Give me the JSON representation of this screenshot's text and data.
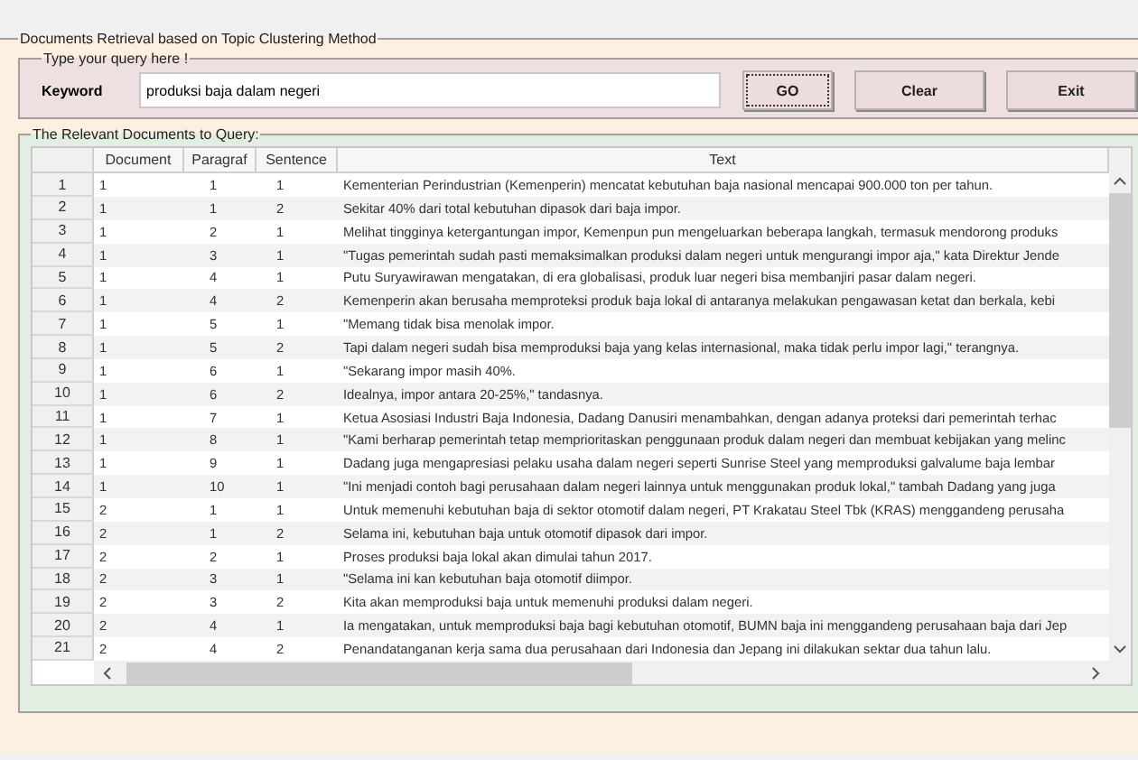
{
  "main_panel": {
    "title": "Documents Retrieval based on Topic Clustering Method"
  },
  "query_panel": {
    "title": "Type your query here !",
    "keyword_label": "Keyword",
    "keyword_value": "produksi baja dalam negeri",
    "buttons": [
      {
        "label": "GO",
        "focused": true
      },
      {
        "label": "Clear",
        "focused": false
      },
      {
        "label": "Exit",
        "focused": false
      }
    ]
  },
  "results_panel": {
    "title": "The Relevant Documents to Query:",
    "table": {
      "columns": [
        "Document",
        "Paragraf",
        "Sentence",
        "Text"
      ],
      "rows": [
        {
          "num": "1",
          "document": "1",
          "paragraf": "1",
          "sentence": "1",
          "text": "Kementerian Perindustrian (Kemenperin) mencatat kebutuhan baja nasional mencapai 900.000 ton per tahun."
        },
        {
          "num": "2",
          "document": "1",
          "paragraf": "1",
          "sentence": "2",
          "text": "Sekitar 40% dari total kebutuhan dipasok dari baja impor."
        },
        {
          "num": "3",
          "document": "1",
          "paragraf": "2",
          "sentence": "1",
          "text": "Melihat tingginya ketergantungan impor, Kemenpun pun mengeluarkan beberapa langkah, termasuk mendorong produks"
        },
        {
          "num": "4",
          "document": "1",
          "paragraf": "3",
          "sentence": "1",
          "text": "\"Tugas pemerintah sudah pasti memaksimalkan produksi dalam negeri untuk mengurangi impor aja,\" kata Direktur Jende"
        },
        {
          "num": "5",
          "document": "1",
          "paragraf": "4",
          "sentence": "1",
          "text": "Putu Suryawirawan mengatakan, di era globalisasi, produk luar negeri bisa membanjiri pasar dalam negeri."
        },
        {
          "num": "6",
          "document": "1",
          "paragraf": "4",
          "sentence": "2",
          "text": "Kemenperin akan berusaha memproteksi produk baja lokal di antaranya melakukan pengawasan ketat dan berkala, kebi"
        },
        {
          "num": "7",
          "document": "1",
          "paragraf": "5",
          "sentence": "1",
          "text": "\"Memang tidak bisa menolak impor."
        },
        {
          "num": "8",
          "document": "1",
          "paragraf": "5",
          "sentence": "2",
          "text": "Tapi dalam negeri sudah bisa memproduksi baja yang kelas internasional, maka tidak perlu impor lagi,\" terangnya."
        },
        {
          "num": "9",
          "document": "1",
          "paragraf": "6",
          "sentence": "1",
          "text": "\"Sekarang impor masih 40%."
        },
        {
          "num": "10",
          "document": "1",
          "paragraf": "6",
          "sentence": "2",
          "text": "Idealnya, impor antara 20-25%,\" tandasnya."
        },
        {
          "num": "11",
          "document": "1",
          "paragraf": "7",
          "sentence": "1",
          "text": "Ketua Asosiasi Industri Baja Indonesia, Dadang Danusiri menambahkan, dengan adanya proteksi dari pemerintah terhac"
        },
        {
          "num": "12",
          "document": "1",
          "paragraf": "8",
          "sentence": "1",
          "text": "\"Kami berharap pemerintah tetap memprioritaskan penggunaan produk dalam negeri dan membuat kebijakan yang melinc"
        },
        {
          "num": "13",
          "document": "1",
          "paragraf": "9",
          "sentence": "1",
          "text": "Dadang juga mengapresiasi pelaku usaha dalam negeri seperti Sunrise Steel yang memproduksi galvalume baja lembar"
        },
        {
          "num": "14",
          "document": "1",
          "paragraf": "10",
          "sentence": "1",
          "text": "\"Ini menjadi contoh bagi perusahaan dalam negeri lainnya untuk menggunakan produk lokal,\" tambah Dadang yang juga"
        },
        {
          "num": "15",
          "document": "2",
          "paragraf": "1",
          "sentence": "1",
          "text": "Untuk memenuhi kebutuhan baja di sektor otomotif dalam negeri, PT Krakatau Steel Tbk (KRAS) menggandeng perusaha"
        },
        {
          "num": "16",
          "document": "2",
          "paragraf": "1",
          "sentence": "2",
          "text": "Selama ini, kebutuhan baja untuk otomotif dipasok dari impor."
        },
        {
          "num": "17",
          "document": "2",
          "paragraf": "2",
          "sentence": "1",
          "text": "Proses produksi baja lokal akan dimulai tahun 2017."
        },
        {
          "num": "18",
          "document": "2",
          "paragraf": "3",
          "sentence": "1",
          "text": "\"Selama ini kan kebutuhan baja otomotif diimpor."
        },
        {
          "num": "19",
          "document": "2",
          "paragraf": "3",
          "sentence": "2",
          "text": "Kita akan memproduksi baja untuk memenuhi produksi dalam negeri."
        },
        {
          "num": "20",
          "document": "2",
          "paragraf": "4",
          "sentence": "1",
          "text": "Ia mengatakan, untuk memproduksi baja bagi kebutuhan otomotif, BUMN baja ini menggandeng perusahaan baja dari Jep"
        },
        {
          "num": "21",
          "document": "2",
          "paragraf": "4",
          "sentence": "2",
          "text": "Penandatanganan kerja sama dua perusahaan dari Indonesia dan Jepang ini dilakukan sektar dua tahun lalu."
        }
      ]
    }
  }
}
